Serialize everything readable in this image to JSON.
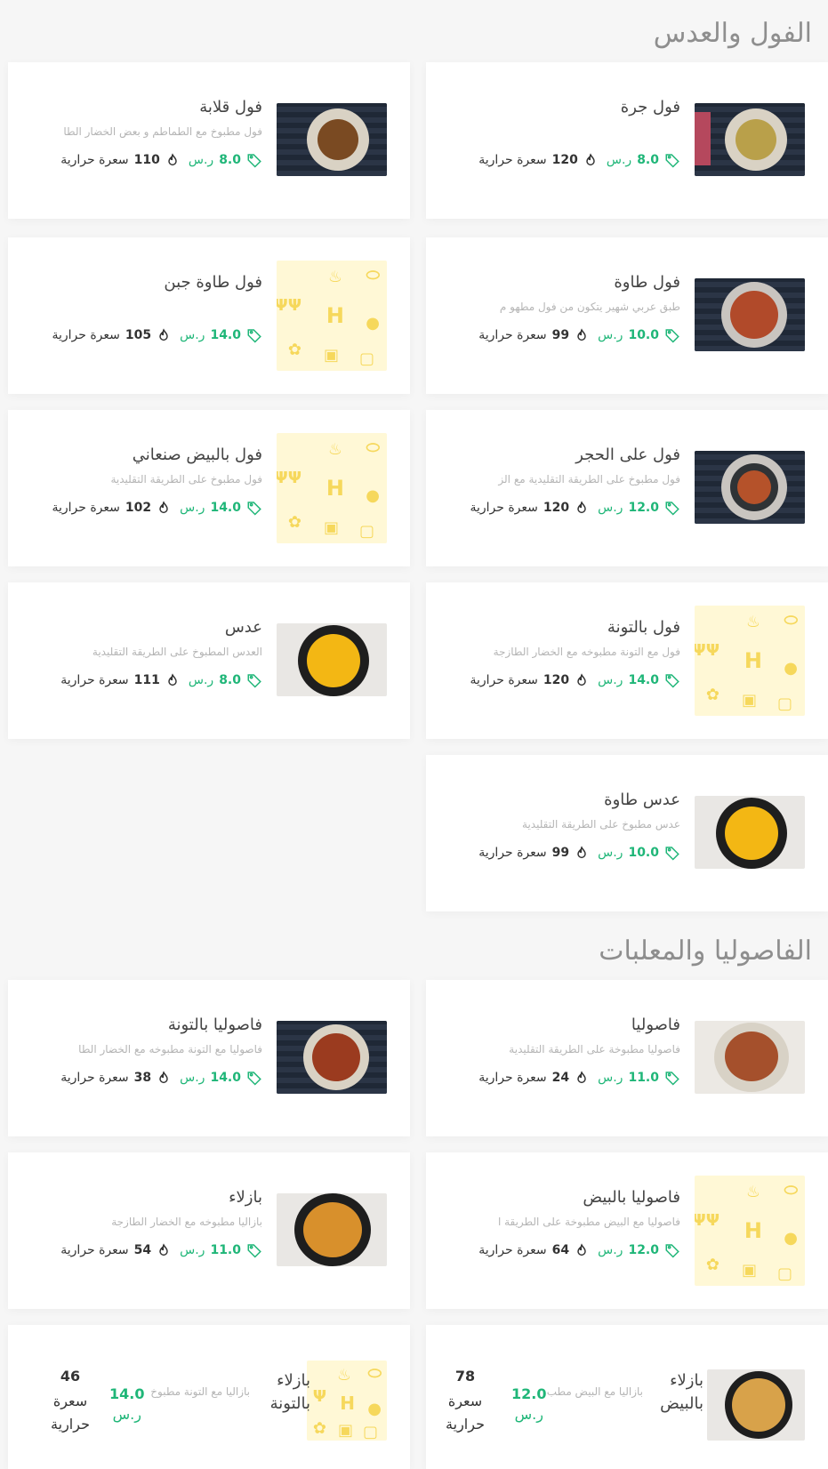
{
  "sections": [
    {
      "title": "الفول والعدس"
    },
    {
      "title": "الفاصوليا والمعلبات"
    }
  ],
  "currency": "ر.س",
  "cal_label": "سعرة حرارية",
  "items": {
    "ful_jarra": {
      "name": "فول جرة",
      "desc": "",
      "price": "8.0",
      "cal": "120"
    },
    "ful_qalaba": {
      "name": "فول قلابة",
      "desc": "فول مطبوخ مع الطماطم و بعض الخضار الطا",
      "price": "8.0",
      "cal": "110"
    },
    "ful_tawa": {
      "name": "فول طاوة",
      "desc": "طبق عربي شهير يتكون من فول مطهو م",
      "price": "10.0",
      "cal": "99"
    },
    "ful_tawa_jubn": {
      "name": "فول طاوة جبن",
      "desc": "",
      "price": "14.0",
      "cal": "105"
    },
    "ful_hajar": {
      "name": "فول على الحجر",
      "desc": "فول مطبوخ على الطريقة التقليدية مع الز",
      "price": "12.0",
      "cal": "120"
    },
    "ful_bayd_sanaani": {
      "name": "فول بالبيض صنعاني",
      "desc": "فول مطبوخ على الطريقة التقليدية",
      "price": "14.0",
      "cal": "102"
    },
    "ful_tuna": {
      "name": "فول بالتونة",
      "desc": "فول مع التونة مطبوخه مع الخضار الطازجة",
      "price": "14.0",
      "cal": "120"
    },
    "adas": {
      "name": "عدس",
      "desc": "العدس المطبوخ على الطريقة التقليدية",
      "price": "8.0",
      "cal": "111"
    },
    "adas_tawa": {
      "name": "عدس طاوة",
      "desc": "عدس مطبوخ على الطريقة التقليدية",
      "price": "10.0",
      "cal": "99"
    },
    "fasolia": {
      "name": "فاصوليا",
      "desc": "فاصوليا مطبوخة على الطريقة التقليدية",
      "price": "11.0",
      "cal": "24"
    },
    "fasolia_tuna": {
      "name": "فاصوليا بالتونة",
      "desc": "فاصوليا مع التونة مطبوخه مع الخضار الطا",
      "price": "14.0",
      "cal": "38"
    },
    "fasolia_bayd": {
      "name": "فاصوليا بالبيض",
      "desc": "فاصوليا مع البيض مطبوخة على الطريقة ا",
      "price": "12.0",
      "cal": "64"
    },
    "bazela": {
      "name": "بازلاء",
      "desc": "بازاليا مطبوخه مع الخضار الطازجة",
      "price": "11.0",
      "cal": "54"
    },
    "bazela_bayd": {
      "name": "بازلاء بالبيض",
      "desc": "بازاليا مع البيض مطب",
      "price": "12.0",
      "cal": "78"
    },
    "bazela_tuna": {
      "name": "بازلاء بالتونة",
      "desc": "بازاليا مع التونة مطبوخ",
      "price": "14.0",
      "cal": "46"
    }
  },
  "icons": {
    "price": "tag-icon",
    "calories": "fire-icon"
  },
  "colors": {
    "accent": "#1fb678",
    "placeholder_bg": "#fff8d6",
    "placeholder_fg": "#f6d85c"
  }
}
